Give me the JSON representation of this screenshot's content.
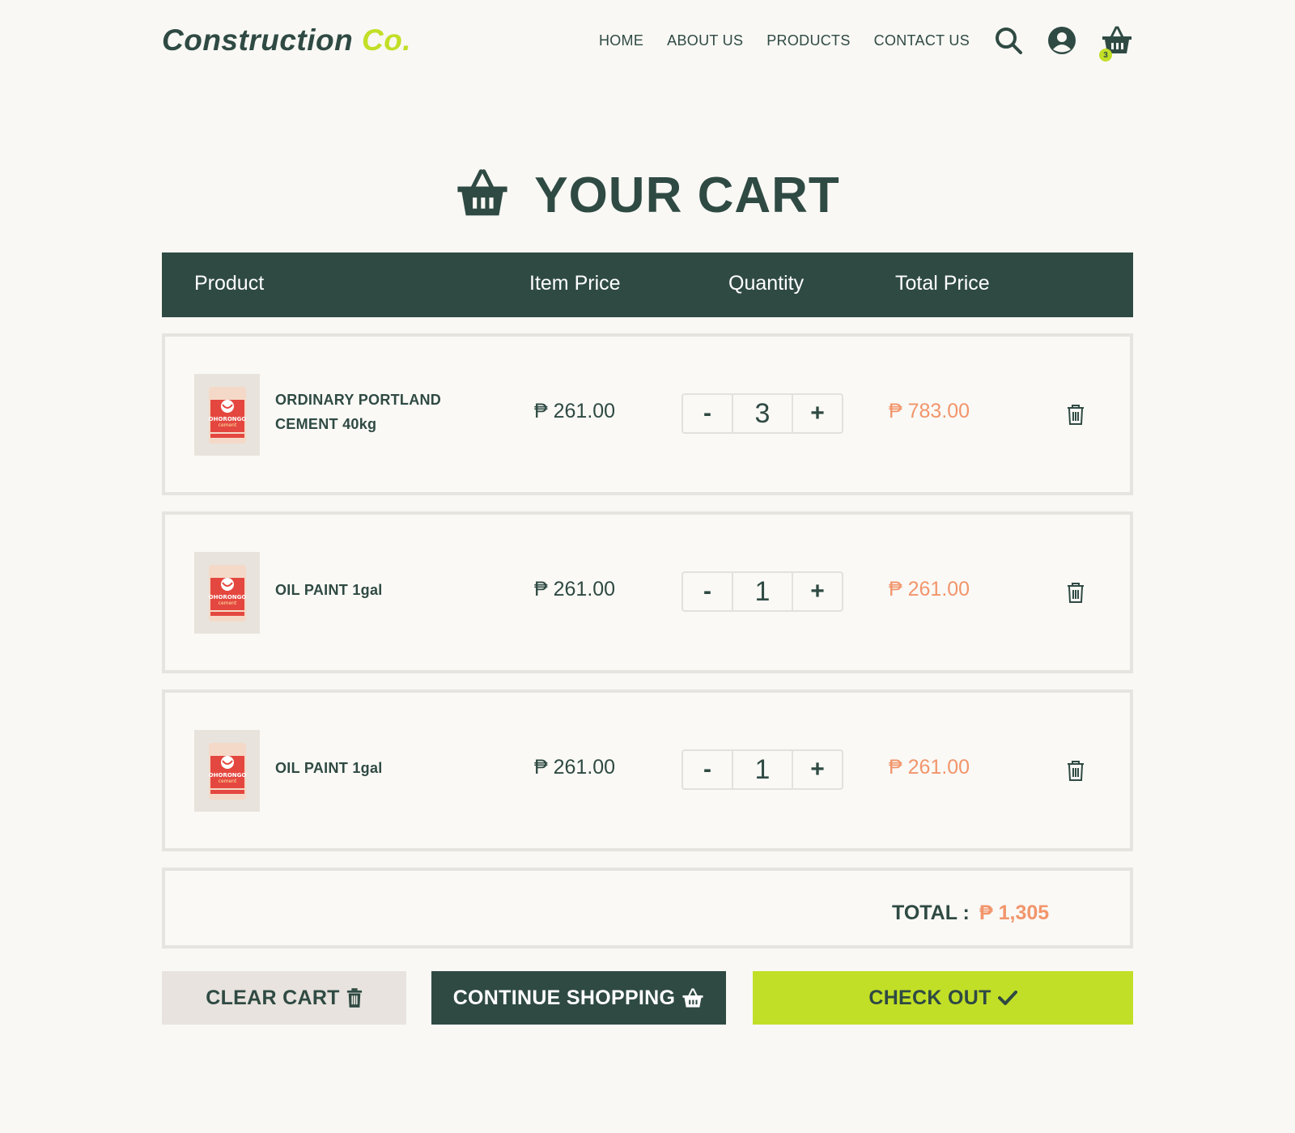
{
  "brand": {
    "name": "Construction",
    "suffix": "Co."
  },
  "nav": {
    "items": [
      "HOME",
      "ABOUT US",
      "PRODUCTS",
      "CONTACT US"
    ],
    "cart_count": "3"
  },
  "page": {
    "title": "YOUR CART"
  },
  "table": {
    "headers": {
      "product": "Product",
      "item_price": "Item Price",
      "quantity": "Quantity",
      "total_price": "Total Price"
    }
  },
  "cart": {
    "items": [
      {
        "name_line1": "ORDINARY PORTLAND",
        "name_line2": "CEMENT 40kg",
        "price": "₱ 261.00",
        "qty": "3",
        "total": "₱ 783.00",
        "image_label": "OHORONGO",
        "image_sub": "cement"
      },
      {
        "name_line1": "OIL PAINT 1gal",
        "name_line2": "",
        "price": "₱ 261.00",
        "qty": "1",
        "total": "₱ 261.00",
        "image_label": "OHORONGO",
        "image_sub": "cement"
      },
      {
        "name_line1": "OIL PAINT 1gal",
        "name_line2": "",
        "price": "₱ 261.00",
        "qty": "1",
        "total": "₱ 261.00",
        "image_label": "OHORONGO",
        "image_sub": "cement"
      }
    ],
    "qty_minus": "-",
    "qty_plus": "+"
  },
  "summary": {
    "label": "TOTAL :",
    "value": "₱ 1,305"
  },
  "actions": {
    "clear": "CLEAR CART",
    "continue": "CONTINUE SHOPPING",
    "checkout": "CHECK OUT"
  },
  "colors": {
    "primary": "#2f4a43",
    "accent": "#c2df27",
    "price_highlight": "#f2956b",
    "background": "#f9f8f5"
  }
}
